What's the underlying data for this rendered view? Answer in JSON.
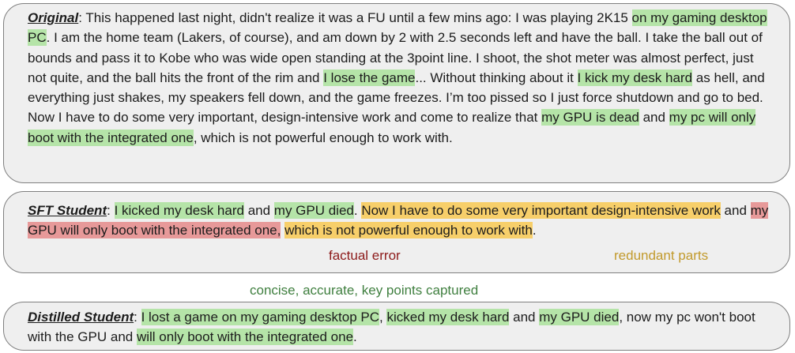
{
  "original": {
    "label": "Original",
    "segments": [
      {
        "text": ": This happened last night, didn't realize it was a FU until a few mins ago: I was playing 2K15 ",
        "hl": ""
      },
      {
        "text": "on my gaming desktop PC",
        "hl": "green"
      },
      {
        "text": ". I am the home team (Lakers, of course), and am down by 2 with 2.5 seconds left and have the ball. I take the ball out of bounds and pass it to Kobe who was wide open standing at the 3point line. I shoot, the shot meter was almost perfect, just not quite, and the ball hits the front of the rim and ",
        "hl": ""
      },
      {
        "text": "I lose the game",
        "hl": "green"
      },
      {
        "text": "... Without thinking about it ",
        "hl": ""
      },
      {
        "text": "I kick my desk hard",
        "hl": "green"
      },
      {
        "text": " as hell, and everything just shakes, my speakers fell down, and the game freezes. I’m too pissed so I just force shutdown and go to bed. Now I have to do some very important, design-intensive work and come to realize that ",
        "hl": ""
      },
      {
        "text": "my GPU is dead",
        "hl": "green"
      },
      {
        "text": " and ",
        "hl": ""
      },
      {
        "text": "my pc will only boot with the integrated one",
        "hl": "green"
      },
      {
        "text": ", which is not powerful enough to work with.",
        "hl": ""
      }
    ]
  },
  "sft": {
    "label": "SFT Student",
    "segments": [
      {
        "text": ": ",
        "hl": ""
      },
      {
        "text": "I kicked my desk hard",
        "hl": "green"
      },
      {
        "text": " and ",
        "hl": ""
      },
      {
        "text": "my GPU died",
        "hl": "green"
      },
      {
        "text": ". ",
        "hl": ""
      },
      {
        "text": "Now I have to do some very important design-intensive work",
        "hl": "yellow"
      },
      {
        "text": " and ",
        "hl": ""
      },
      {
        "text": "my GPU will only boot with the integrated one,",
        "hl": "red"
      },
      {
        "text": " ",
        "hl": ""
      },
      {
        "text": "which is not powerful enough to work with",
        "hl": "yellow"
      },
      {
        "text": ".",
        "hl": ""
      }
    ],
    "note_factual": "factual error",
    "note_redundant": "redundant parts"
  },
  "distilled": {
    "label": "Distilled Student",
    "note_concise": "concise, accurate, key points captured",
    "segments": [
      {
        "text": ": ",
        "hl": ""
      },
      {
        "text": "I lost a game on my gaming desktop PC",
        "hl": "green"
      },
      {
        "text": ", ",
        "hl": ""
      },
      {
        "text": "kicked my desk hard",
        "hl": "green"
      },
      {
        "text": " and ",
        "hl": ""
      },
      {
        "text": "my GPU died",
        "hl": "green"
      },
      {
        "text": ", now my pc won't boot with the GPU and ",
        "hl": ""
      },
      {
        "text": "will only boot with the integrated one",
        "hl": "green"
      },
      {
        "text": ".",
        "hl": ""
      }
    ]
  },
  "colors": {
    "panel_bg": "#efefef",
    "panel_border": "#7f7f7f",
    "highlight_green": "#b5e4a8",
    "highlight_yellow": "#f7cf6a",
    "highlight_red": "#e79999",
    "note_factual": "#8d1b1b",
    "note_redundant": "#c29a2c",
    "note_concise": "#3f7f3f"
  }
}
